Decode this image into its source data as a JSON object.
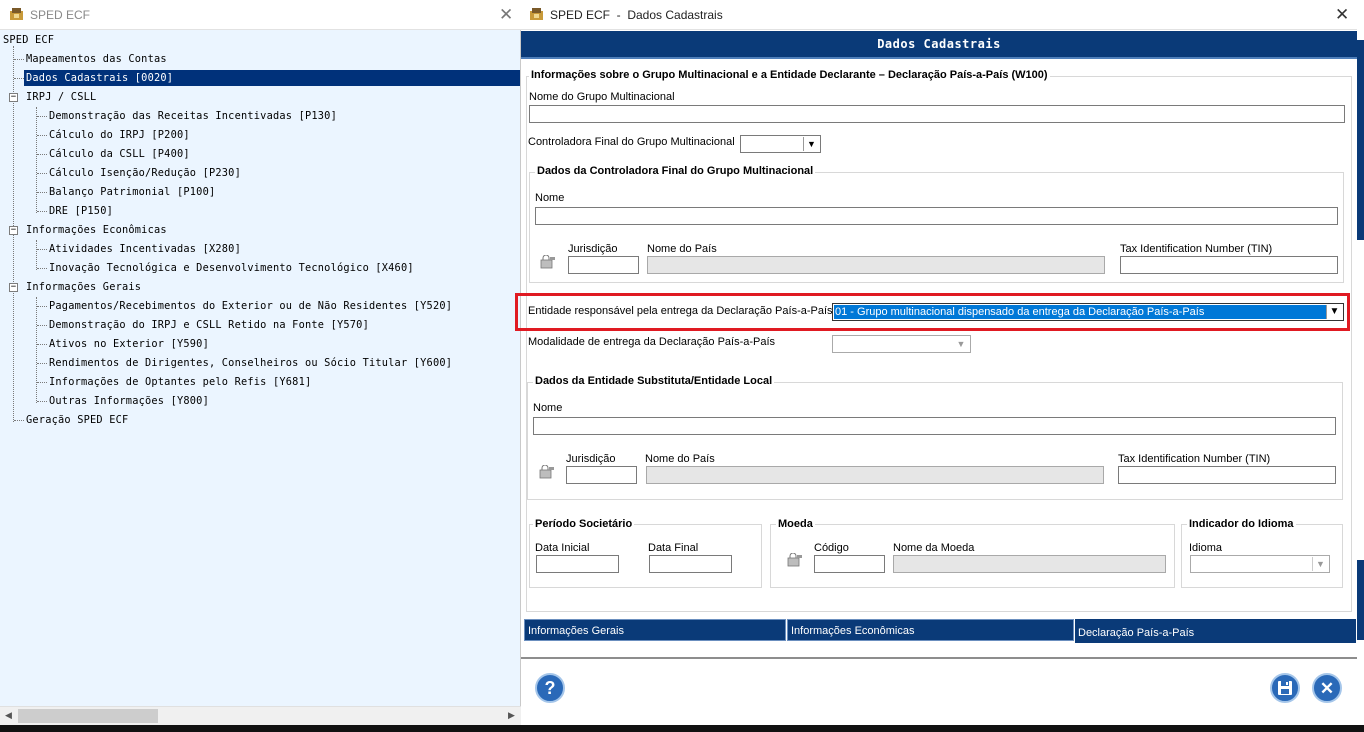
{
  "left_window": {
    "title": "SPED ECF",
    "tree": {
      "root": "SPED ECF",
      "items": [
        {
          "label": "Mapeamentos das Contas"
        },
        {
          "label": "Dados Cadastrais [0020]"
        },
        {
          "label": "IRPJ / CSLL"
        },
        {
          "label": "Demonstração das Receitas Incentivadas [P130]"
        },
        {
          "label": "Cálculo do IRPJ [P200]"
        },
        {
          "label": "Cálculo da CSLL [P400]"
        },
        {
          "label": "Cálculo Isenção/Redução [P230]"
        },
        {
          "label": "Balanço Patrimonial [P100]"
        },
        {
          "label": "DRE [P150]"
        },
        {
          "label": "Informações Econômicas"
        },
        {
          "label": "Atividades Incentivadas [X280]"
        },
        {
          "label": "Inovação Tecnológica e Desenvolvimento Tecnológico [X460]"
        },
        {
          "label": "Informações Gerais"
        },
        {
          "label": "Pagamentos/Recebimentos do Exterior ou de Não Residentes [Y520]"
        },
        {
          "label": "Demonstração do IRPJ e CSLL Retido na Fonte [Y570]"
        },
        {
          "label": "Ativos no Exterior [Y590]"
        },
        {
          "label": "Rendimentos de Dirigentes, Conselheiros ou Sócio Titular [Y600]"
        },
        {
          "label": "Informações de Optantes pelo Refis [Y681]"
        },
        {
          "label": "Outras Informações [Y800]"
        },
        {
          "label": "Geração SPED ECF"
        }
      ],
      "selected": "Dados Cadastrais [0020]"
    }
  },
  "right_window": {
    "title": "SPED ECF  -  Dados Cadastrais",
    "header": "Dados Cadastrais",
    "main_group_title": "Informações sobre o Grupo Multinacional e a Entidade Declarante – Declaração País-a-País (W100)",
    "nome_grupo_label": "Nome do Grupo Multinacional",
    "nome_grupo_value": "",
    "controladora_label": "Controladora Final do Grupo Multinacional",
    "controladora_value": "",
    "controladora_group": {
      "title": "Dados da Controladora Final do Grupo Multinacional",
      "nome_label": "Nome",
      "nome_value": "",
      "jurisdicao_label": "Jurisdição",
      "jurisdicao_value": "",
      "pais_label": "Nome do País",
      "pais_value": "",
      "tin_label": "Tax Identification Number (TIN)",
      "tin_value": ""
    },
    "entidade_label": "Entidade responsável pela entrega da Declaração País-a-País",
    "entidade_value": "01 - Grupo multinacional dispensado da entrega da Declaração País-a-País",
    "modalidade_label": "Modalidade de entrega da Declaração País-a-País",
    "modalidade_value": "",
    "substituta_group": {
      "title": "Dados da Entidade Substituta/Entidade Local",
      "nome_label": "Nome",
      "nome_value": "",
      "jurisdicao_label": "Jurisdição",
      "jurisdicao_value": "",
      "pais_label": "Nome do País",
      "pais_value": "",
      "tin_label": "Tax Identification Number (TIN)",
      "tin_value": ""
    },
    "periodo_group": {
      "title": "Período Societário",
      "data_inicial_label": "Data Inicial",
      "data_final_label": "Data Final"
    },
    "moeda_group": {
      "title": "Moeda",
      "codigo_label": "Código",
      "nome_moeda_label": "Nome da Moeda"
    },
    "idioma_group": {
      "title": "Indicador do Idioma",
      "idioma_label": "Idioma",
      "idioma_value": ""
    },
    "tabs": [
      {
        "label": "Informações Gerais"
      },
      {
        "label": "Informações Econômicas"
      },
      {
        "label": "Declaração País-a-País"
      }
    ],
    "active_tab": "Declaração País-a-País",
    "buttons": {
      "help_symbol": "?",
      "close_symbol": "✕"
    }
  },
  "colors": {
    "header_blue": "#0a3a78",
    "selection_blue": "#00317a",
    "tree_background": "#ebf5ff",
    "highlight_red": "#e01a22",
    "dropdown_selected": "#0078d7"
  }
}
